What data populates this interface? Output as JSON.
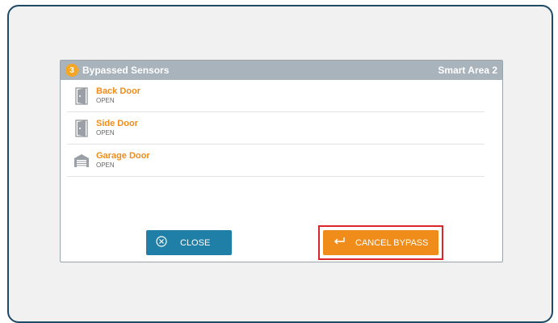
{
  "dialog": {
    "count": "3",
    "title": "Bypassed Sensors",
    "area": "Smart Area 2"
  },
  "sensors": [
    {
      "name": "Back Door",
      "status": "OPEN",
      "icon": "door-icon"
    },
    {
      "name": "Side Door",
      "status": "OPEN",
      "icon": "door-icon"
    },
    {
      "name": "Garage Door",
      "status": "OPEN",
      "icon": "garage-door-icon"
    }
  ],
  "buttons": {
    "close_label": "CLOSE",
    "close_icon": "close-circle-icon",
    "cancel_label": "CANCEL BYPASS",
    "cancel_icon": "return-arrow-icon"
  },
  "colors": {
    "accent_orange": "#f08c1a",
    "close_blue": "#1f7fa6",
    "header_gray": "#a9b3bb",
    "highlight_red": "#d8262a"
  }
}
